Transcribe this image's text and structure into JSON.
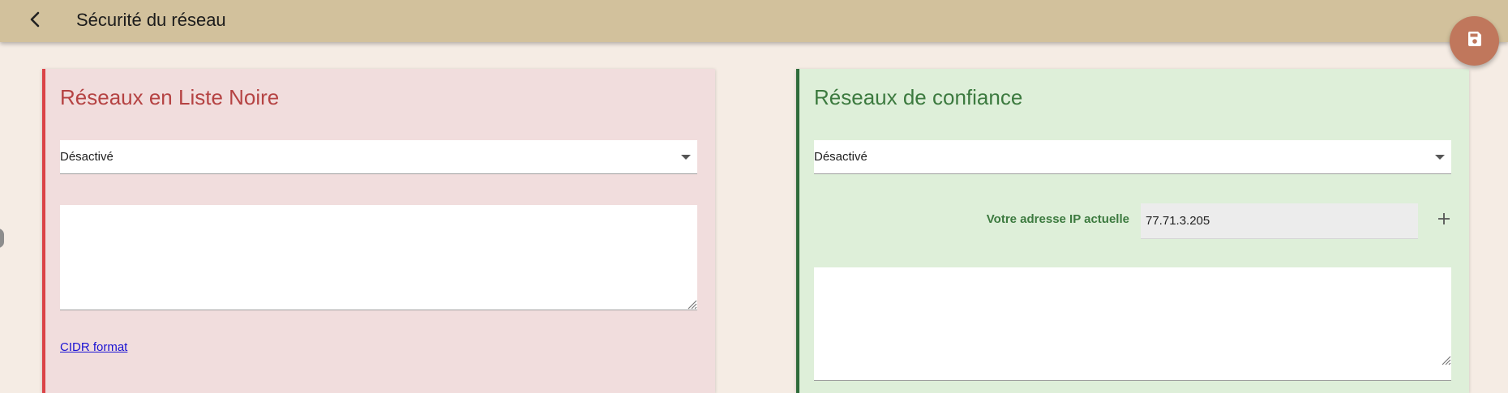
{
  "app_bar": {
    "back_icon": "arrow-back-icon",
    "title": "Sécurité du réseau"
  },
  "save_fab": {
    "icon": "save-icon",
    "color": "#c0775c"
  },
  "blacklist": {
    "title": "Réseaux en Liste Noire",
    "accent": "#db4347",
    "mode": {
      "value": "Désactivé"
    },
    "networks_text": "",
    "cidr_link": "CIDR format"
  },
  "trusted": {
    "title": "Réseaux de confiance",
    "accent": "#2e6b3a",
    "mode": {
      "value": "Désactivé"
    },
    "current_ip": {
      "label": "Votre adresse IP actuelle",
      "value": "77.71.3.205"
    },
    "add_icon": "plus-icon",
    "networks_text": ""
  }
}
